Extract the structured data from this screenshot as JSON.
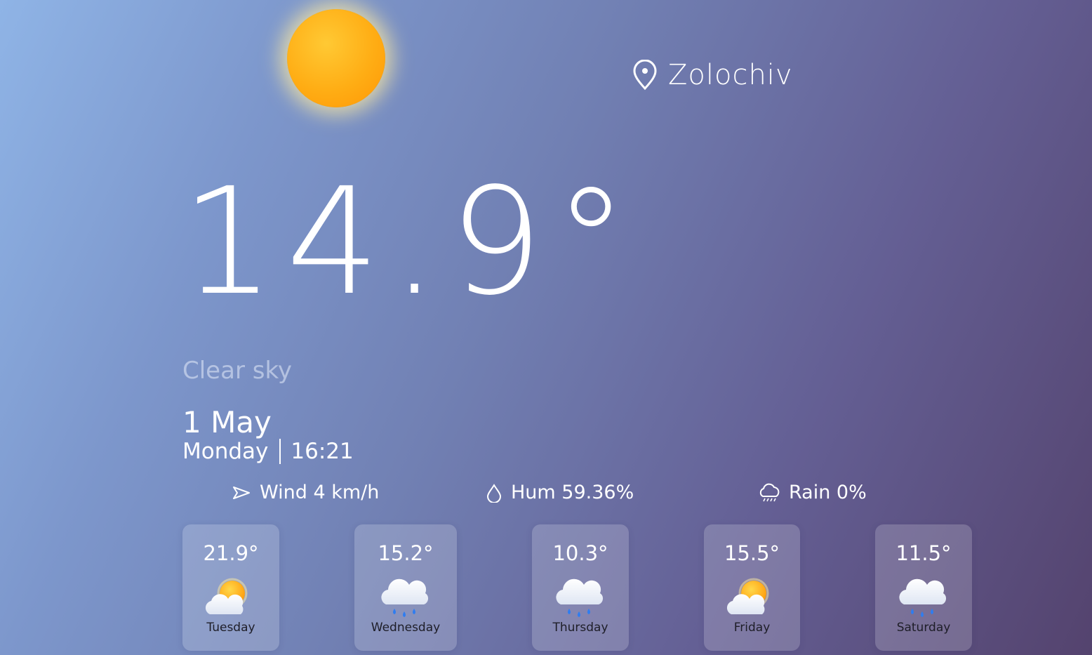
{
  "location": {
    "city": "Zolochiv",
    "icon": "map-pin-icon"
  },
  "current": {
    "temperature": "14.9°",
    "condition": "Clear sky",
    "date": "1 May",
    "weekday": "Monday",
    "time": "16:21",
    "icon": "sun-icon"
  },
  "stats": {
    "wind": {
      "text": "Wind 4 km/h",
      "icon": "wind-arrow-icon"
    },
    "humidity": {
      "text": "Hum 59.36%",
      "icon": "droplet-icon"
    },
    "rain": {
      "text": "Rain 0%",
      "icon": "rain-cloud-icon"
    }
  },
  "forecast": [
    {
      "day": "Tuesday",
      "temp": "21.9°",
      "icon": "partly-cloudy-icon"
    },
    {
      "day": "Wednesday",
      "temp": "15.2°",
      "icon": "rain-icon"
    },
    {
      "day": "Thursday",
      "temp": "10.3°",
      "icon": "rain-icon"
    },
    {
      "day": "Friday",
      "temp": "15.5°",
      "icon": "partly-cloudy-icon"
    },
    {
      "day": "Saturday",
      "temp": "11.5°",
      "icon": "rain-icon"
    }
  ],
  "colors": {
    "sun": "#ffad14",
    "background_start": "#8fb4e6",
    "background_end": "#54436e",
    "rain_drop": "#2f7df0"
  }
}
